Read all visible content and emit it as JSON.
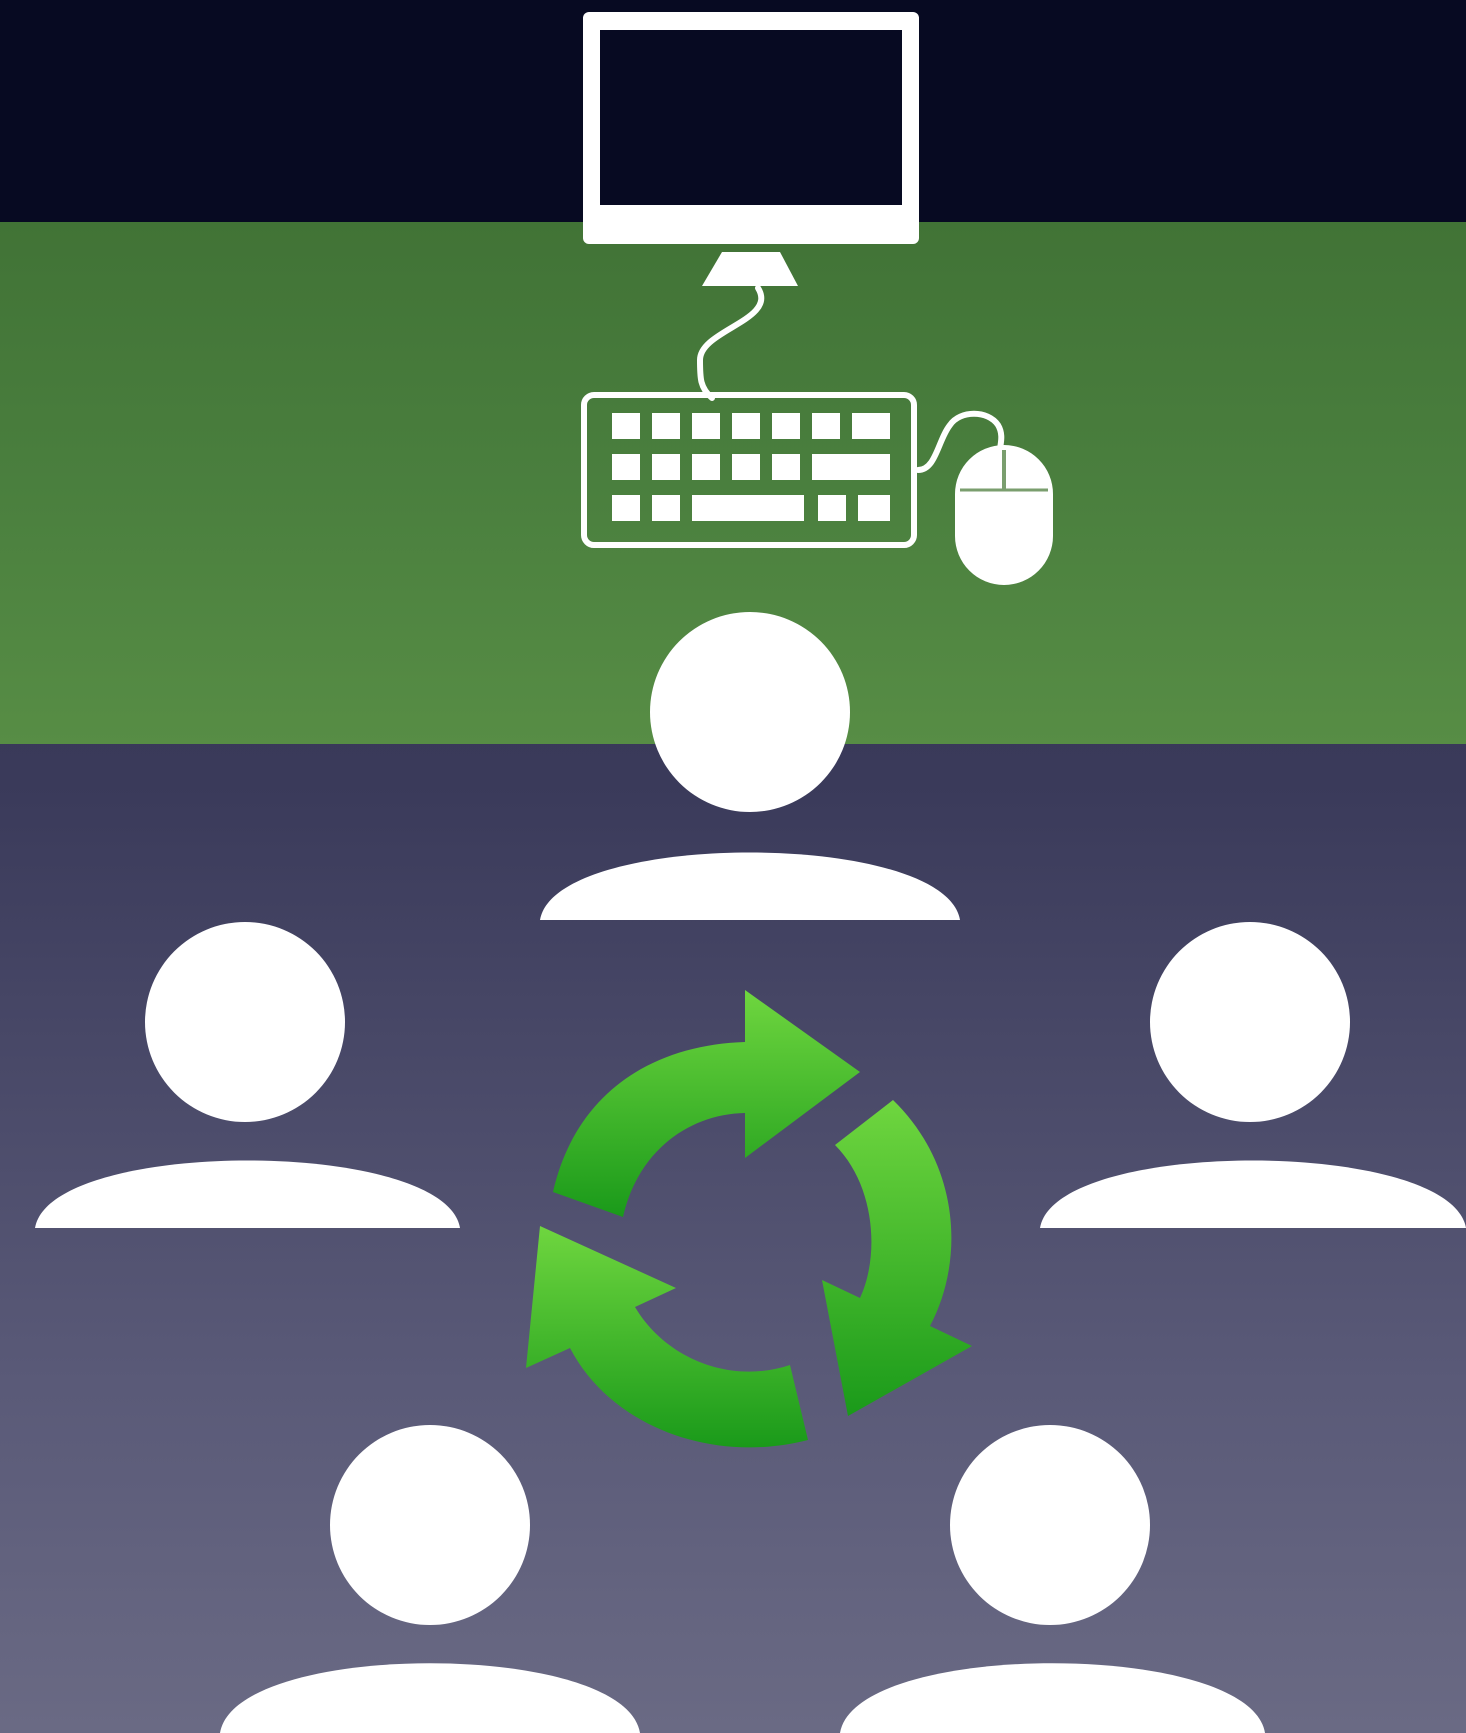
{
  "scene": {
    "colors": {
      "top_band": "#070a22",
      "green_band": "#4a7f3e",
      "lower_gradient_top": "#2a2a48",
      "lower_gradient_bottom": "#6a6a84",
      "figure": "#ffffff",
      "cycle_arrows": "#3cb82e"
    },
    "icons": [
      "computer-monitor-icon",
      "keyboard-icon",
      "mouse-icon",
      "person-icon",
      "refresh-cycle-icon"
    ],
    "people_count": 5
  }
}
